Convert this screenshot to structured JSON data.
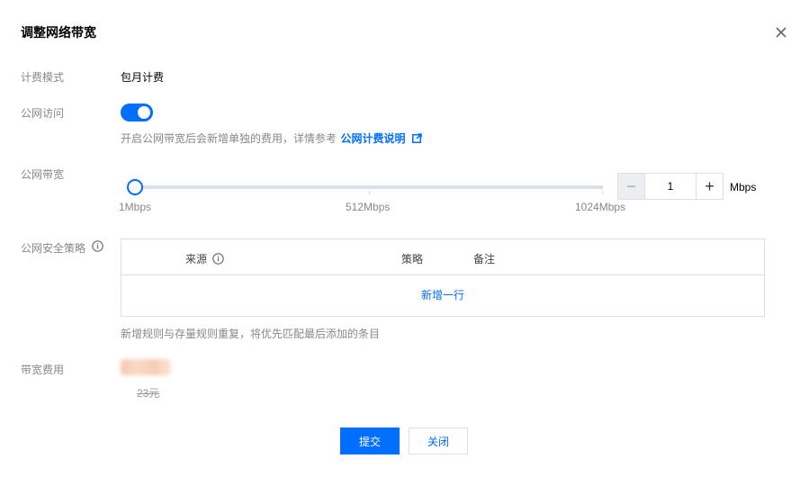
{
  "dialog": {
    "title": "调整网络带宽",
    "close_icon": "close-icon"
  },
  "billing_mode": {
    "label": "计费模式",
    "value": "包月计费"
  },
  "public_access": {
    "label": "公网访问",
    "enabled": true,
    "hint": "开启公网带宽后会新增单独的费用，详情参考",
    "link_text": "公网计费说明",
    "link_icon": "external-link-icon"
  },
  "bandwidth": {
    "label": "公网带宽",
    "value": "1",
    "unit": "Mbps",
    "min": 1,
    "max": 1024,
    "ticks": [
      "1Mbps",
      "512Mbps",
      "1024Mbps"
    ],
    "decrement": "−",
    "increment": "+"
  },
  "security_policy": {
    "label": "公网安全策略",
    "info_icon": "info-icon",
    "columns": [
      "来源",
      "策略",
      "备注"
    ],
    "add_row": "新增一行",
    "hint": "新增规则与存量规则重复，将优先匹配最后添加的条目"
  },
  "bandwidth_cost": {
    "label": "带宽费用",
    "original_price": "23元"
  },
  "footer": {
    "submit": "提交",
    "close": "关闭"
  },
  "colors": {
    "accent": "#006eff",
    "muted": "#888888",
    "border": "#dcdfe6"
  }
}
